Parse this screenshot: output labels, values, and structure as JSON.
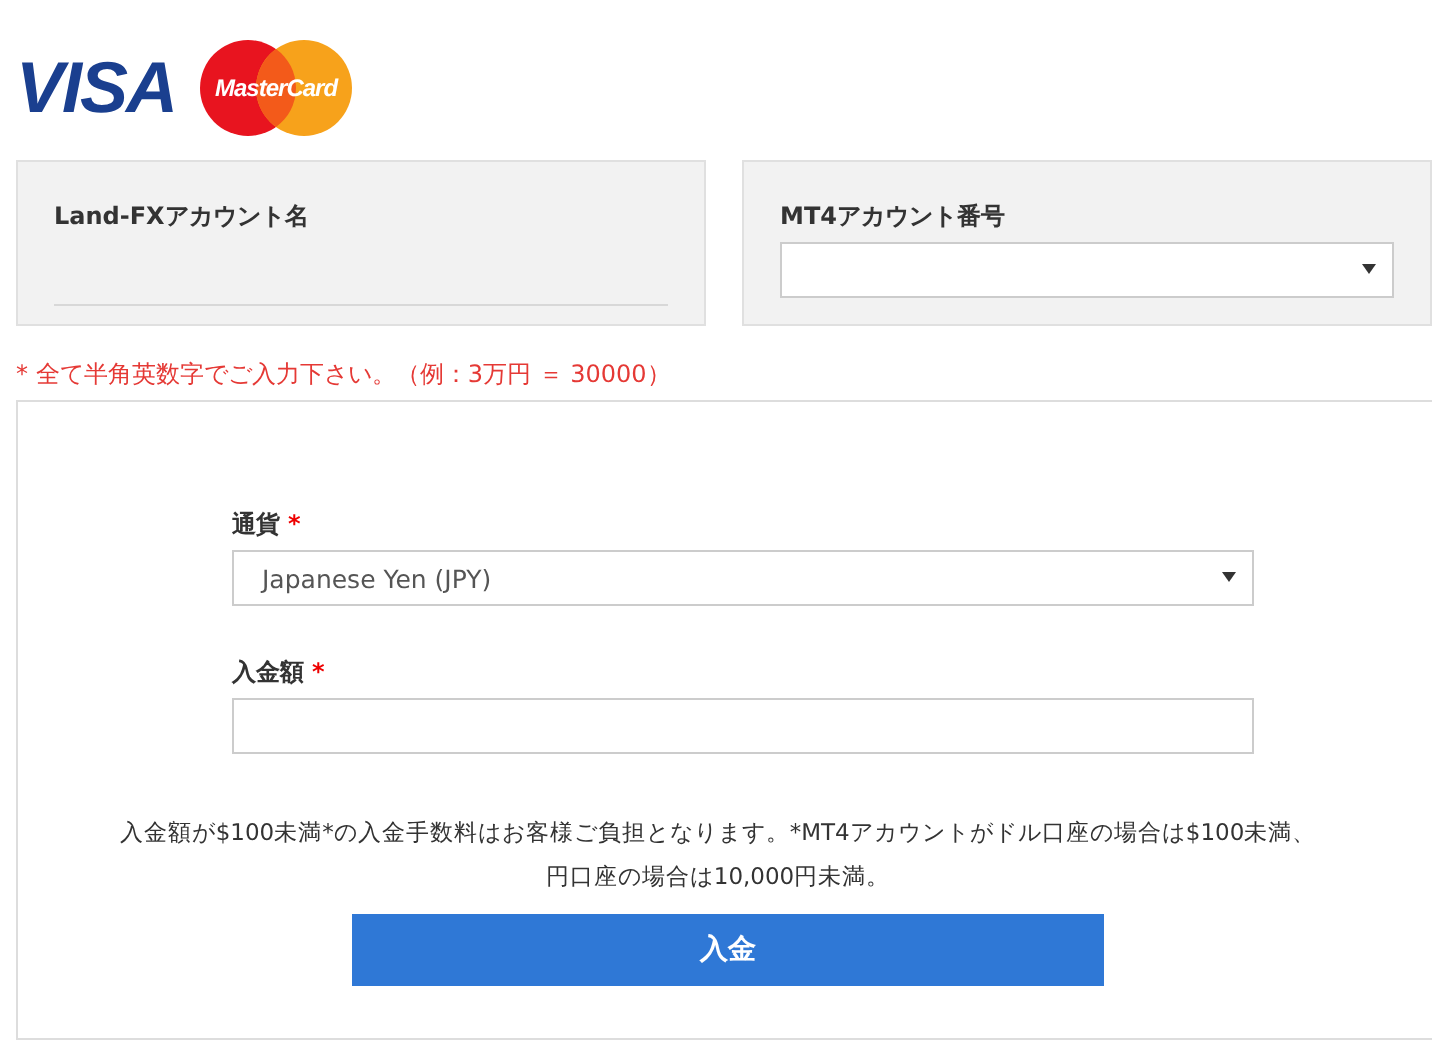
{
  "logos": {
    "visa": "VISA",
    "mastercard": "MasterCard"
  },
  "account_panels": [
    {
      "kind": "text",
      "label": "Land-FXアカウント名"
    },
    {
      "kind": "select",
      "label": "MT4アカウント番号"
    }
  ],
  "note": "* 全て半角英数字でご入力下さい。（例：3万円 ＝ 30000）",
  "form": {
    "fields": [
      {
        "kind": "select",
        "label": "通貨",
        "required_mark": "*",
        "value": "Japanese Yen (JPY)"
      },
      {
        "kind": "input",
        "label": "入金額",
        "required_mark": "*"
      }
    ],
    "fee_note_lines": [
      "入金額が$100未満*の入金手数料はお客様ご負担となります。*MT4アカウントがドル口座の場合は$100未満、",
      "円口座の場合は10,000円未満。"
    ],
    "submit": "入金"
  }
}
